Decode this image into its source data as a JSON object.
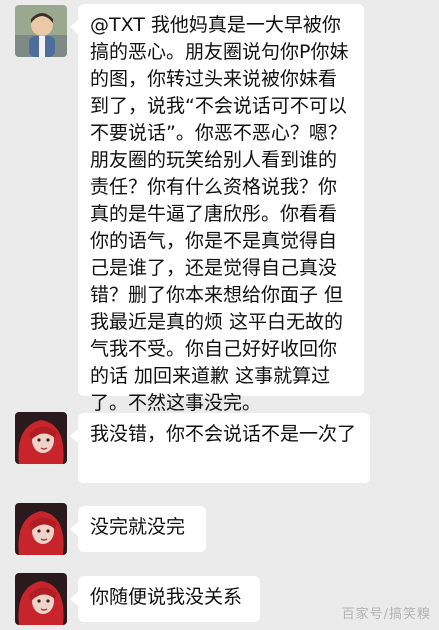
{
  "colors": {
    "background": "#ebebeb",
    "bubble": "#ffffff",
    "text": "#111111"
  },
  "messages": [
    {
      "avatar": "child-photo-avatar",
      "text": "@TXT 我他妈真是一大早被你搞的恶心。朋友圈说句你P你妹的图，你转过头来说被你妹看到了，说我“不会说话可不可以不要说话”。你恶不恶心？嗯？朋友圈的玩笑给别人看到谁的责任？你有什么资格说我？你真的是牛逼了唐欣彤。你看看你的语气，你是不是真觉得自己是谁了，还是觉得自己真没错？删了你本来想给你面子 但我最近是真的烦 这平白无故的气我不受。你自己好好收回你的话 加回来道歉 这事就算过了。不然这事没完。"
    },
    {
      "avatar": "red-hair-girl-avatar",
      "text": "我没错，你不会说话不是一次了"
    },
    {
      "avatar": "red-hair-girl-avatar",
      "text": "没完就没完"
    },
    {
      "avatar": "red-hair-girl-avatar",
      "text": "你随便说我没关系"
    }
  ],
  "watermark": "百家号/搞笑糗"
}
